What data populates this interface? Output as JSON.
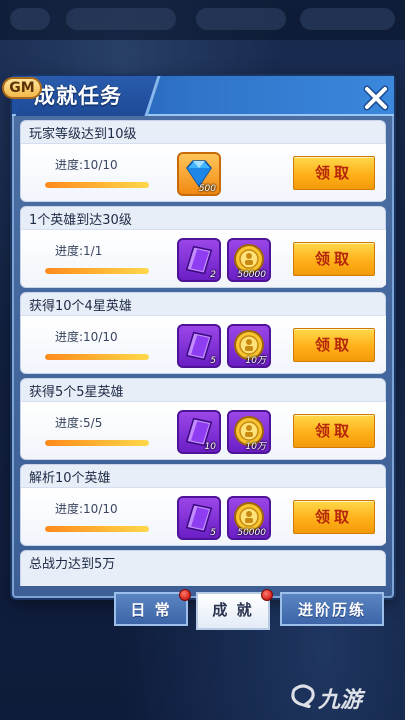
{
  "panel": {
    "title": "成就任务",
    "gm_badge": "GM",
    "progress_prefix": "进度:",
    "claim_label": "领取"
  },
  "tasks": [
    {
      "title": "玩家等级达到10级",
      "progress_text": "进度:10/10",
      "progress": 1.0,
      "rewards": [
        {
          "icon": "diamond-icon",
          "qty": "500"
        }
      ],
      "claim_label": "领取"
    },
    {
      "title": "1个英雄到达30级",
      "progress_text": "进度:1/1",
      "progress": 1.0,
      "rewards": [
        {
          "icon": "purple-crystal-icon",
          "qty": "2"
        },
        {
          "icon": "gold-coin-icon",
          "qty": "50000"
        }
      ],
      "claim_label": "领取"
    },
    {
      "title": "获得10个4星英雄",
      "progress_text": "进度:10/10",
      "progress": 1.0,
      "rewards": [
        {
          "icon": "purple-crystal-icon",
          "qty": "5"
        },
        {
          "icon": "gold-coin-icon",
          "qty": "10万"
        }
      ],
      "claim_label": "领取"
    },
    {
      "title": "获得5个5星英雄",
      "progress_text": "进度:5/5",
      "progress": 1.0,
      "rewards": [
        {
          "icon": "purple-crystal-icon",
          "qty": "10"
        },
        {
          "icon": "gold-coin-icon",
          "qty": "10万"
        }
      ],
      "claim_label": "领取"
    },
    {
      "title": "解析10个英雄",
      "progress_text": "进度:10/10",
      "progress": 1.0,
      "rewards": [
        {
          "icon": "purple-crystal-icon",
          "qty": "5"
        },
        {
          "icon": "gold-coin-icon",
          "qty": "50000"
        }
      ],
      "claim_label": "领取"
    },
    {
      "title": "总战力达到5万"
    }
  ],
  "tabs": [
    {
      "label": "日 常",
      "active": false,
      "red_dot": true
    },
    {
      "label": "成 就",
      "active": true,
      "red_dot": true
    },
    {
      "label": "进阶历练",
      "active": false,
      "red_dot": false
    }
  ],
  "watermark": {
    "text": "九游",
    "logo_icon": "jiuyou-logo-icon"
  },
  "colors": {
    "claim_button": "#ffb01a",
    "claim_text": "#b5260a",
    "progress_fill": "#ff8a1c",
    "panel_blue": "#3d5f96",
    "red_dot": "#d1201a"
  }
}
